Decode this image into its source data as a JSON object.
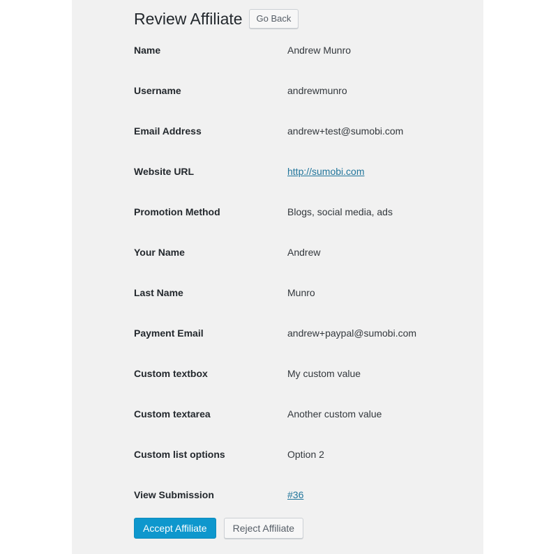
{
  "header": {
    "title": "Review Affiliate",
    "go_back_label": "Go Back"
  },
  "colors": {
    "page_background": "#ffffff",
    "content_background": "#f1f1f1",
    "title_text": "#23282d",
    "label_text": "#23282d",
    "value_text": "#32373c",
    "link": "#21759b",
    "accept_button_background": "#0e97cd",
    "accept_button_text": "#ffffff",
    "secondary_button_background": "#f7f7f7",
    "secondary_button_border": "#ccd0d4",
    "secondary_button_text": "#555d66"
  },
  "fields": [
    {
      "label": "Name",
      "value": "Andrew Munro",
      "is_link": false
    },
    {
      "label": "Username",
      "value": "andrewmunro",
      "is_link": false
    },
    {
      "label": "Email Address",
      "value": "andrew+test@sumobi.com",
      "is_link": false
    },
    {
      "label": "Website URL",
      "value": "http://sumobi.com",
      "is_link": true
    },
    {
      "label": "Promotion Method",
      "value": "Blogs, social media, ads",
      "is_link": false
    },
    {
      "label": "Your Name",
      "value": "Andrew",
      "is_link": false
    },
    {
      "label": "Last Name",
      "value": "Munro",
      "is_link": false
    },
    {
      "label": "Payment Email",
      "value": "andrew+paypal@sumobi.com",
      "is_link": false
    },
    {
      "label": "Custom textbox",
      "value": "My custom value",
      "is_link": false
    },
    {
      "label": "Custom textarea",
      "value": "Another custom value",
      "is_link": false
    },
    {
      "label": "Custom list options",
      "value": "Option 2",
      "is_link": false
    },
    {
      "label": "View Submission",
      "value": "#36",
      "is_link": true
    }
  ],
  "actions": {
    "accept_label": "Accept Affiliate",
    "reject_label": "Reject Affiliate"
  }
}
